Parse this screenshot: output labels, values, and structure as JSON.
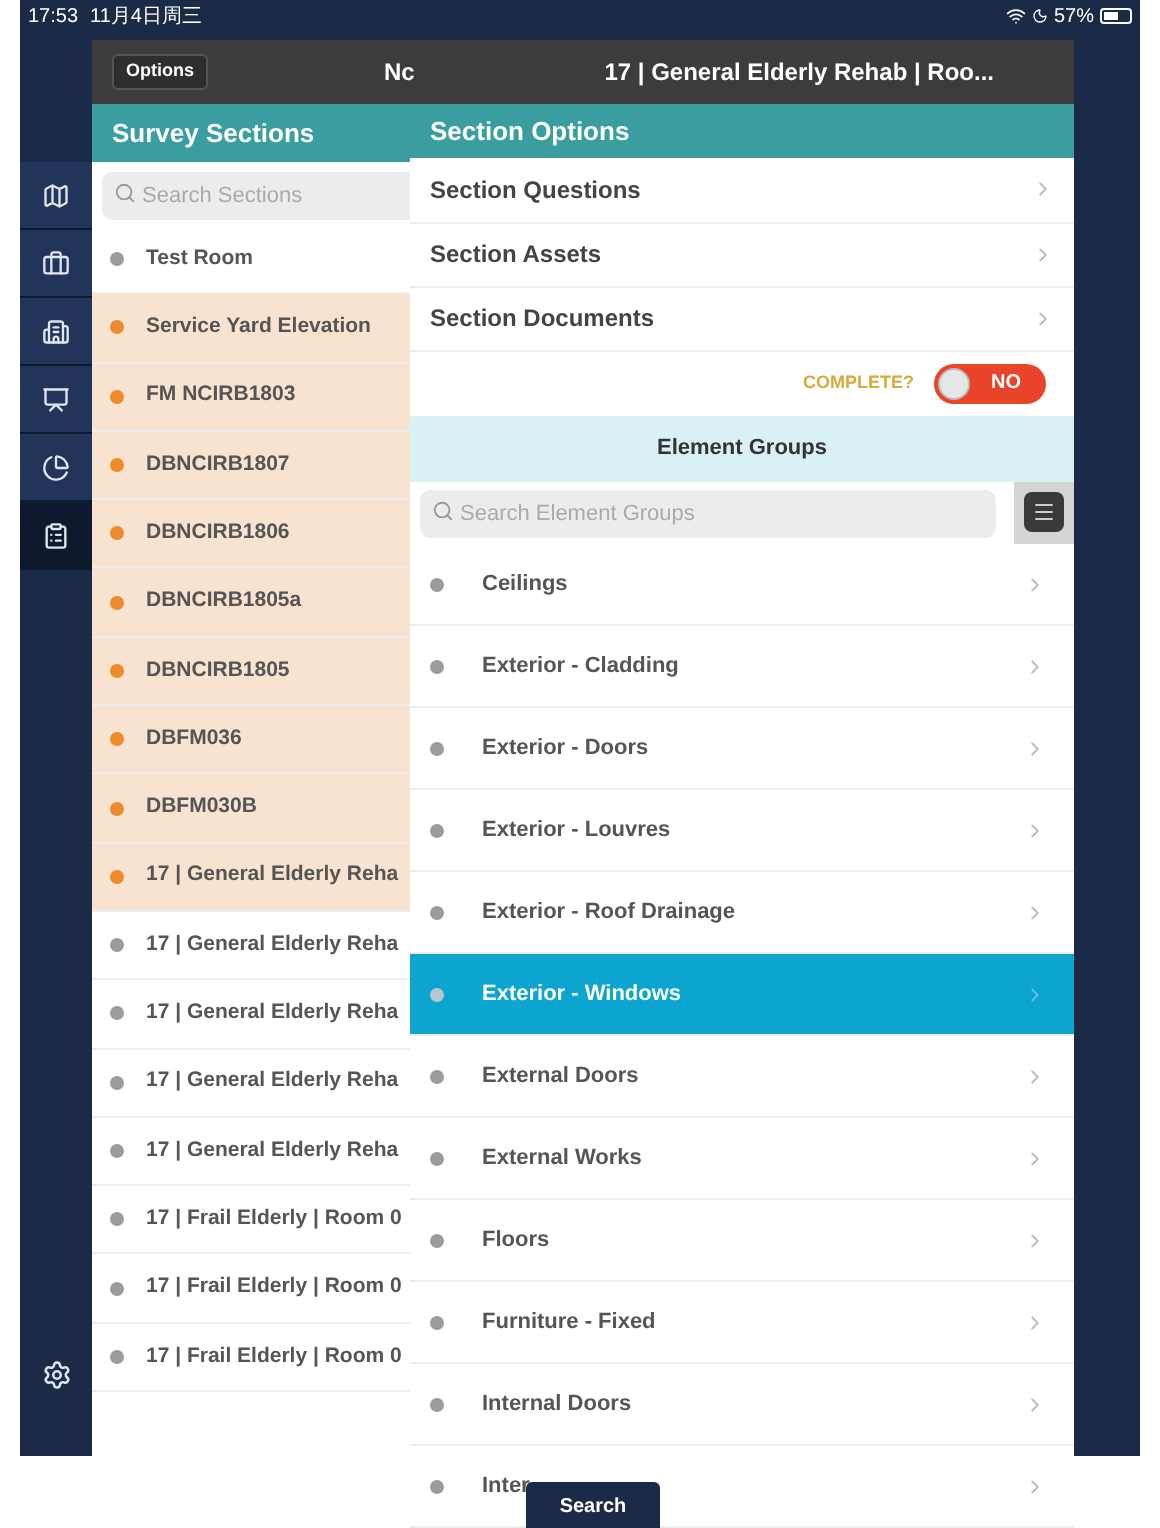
{
  "status_bar": {
    "time": "17:53",
    "date": "11月4日周三",
    "battery": "57%"
  },
  "header": {
    "options_button": "Options",
    "left_title": "Nc",
    "title": "17 | General Elderly Rehab | Roo..."
  },
  "nav_rail": [
    {
      "selected": false
    },
    {
      "selected": false
    },
    {
      "selected": false
    },
    {
      "selected": false
    },
    {
      "selected": false
    },
    {
      "selected": true
    }
  ],
  "survey_sections": {
    "title": "Survey Sections",
    "search_placeholder": "Search Sections",
    "items": [
      {
        "label": "Test Room",
        "color": "#9b9b9b",
        "highlighted": false
      },
      {
        "label": "Service Yard Elevation",
        "color": "#ef8a2c",
        "highlighted": true
      },
      {
        "label": "FM NCIRB1803",
        "color": "#ef8a2c",
        "highlighted": true
      },
      {
        "label": "DBNCIRB1807",
        "color": "#ef8a2c",
        "highlighted": true
      },
      {
        "label": "DBNCIRB1806",
        "color": "#ef8a2c",
        "highlighted": true
      },
      {
        "label": "DBNCIRB1805a",
        "color": "#ef8a2c",
        "highlighted": true
      },
      {
        "label": "DBNCIRB1805",
        "color": "#ef8a2c",
        "highlighted": true
      },
      {
        "label": "DBFM036",
        "color": "#ef8a2c",
        "highlighted": true
      },
      {
        "label": "DBFM030B",
        "color": "#ef8a2c",
        "highlighted": true
      },
      {
        "label": "17 | General Elderly Reha",
        "color": "#ef8a2c",
        "highlighted": true
      },
      {
        "label": "17 | General Elderly Reha",
        "color": "#9b9b9b",
        "highlighted": false
      },
      {
        "label": "17 | General Elderly Reha",
        "color": "#9b9b9b",
        "highlighted": false
      },
      {
        "label": "17 | General Elderly Reha",
        "color": "#9b9b9b",
        "highlighted": false
      },
      {
        "label": "17 | General Elderly Reha",
        "color": "#9b9b9b",
        "highlighted": false
      },
      {
        "label": "17 | Frail Elderly | Room 0",
        "color": "#9b9b9b",
        "highlighted": false
      },
      {
        "label": "17 | Frail Elderly | Room 0",
        "color": "#9b9b9b",
        "highlighted": false
      },
      {
        "label": "17 | Frail Elderly | Room 0",
        "color": "#9b9b9b",
        "highlighted": false
      }
    ]
  },
  "section_options": {
    "title": "Section Options",
    "items": [
      "Section Questions",
      "Section Assets",
      "Section Documents"
    ],
    "complete": {
      "label": "COMPLETE?",
      "on": false,
      "value": "NO"
    }
  },
  "element_groups": {
    "title": "Element Groups",
    "search_placeholder": "Search Element Groups",
    "items": [
      {
        "label": "Ceilings",
        "selected": false
      },
      {
        "label": "Exterior - Cladding",
        "selected": false
      },
      {
        "label": "Exterior - Doors",
        "selected": false
      },
      {
        "label": "Exterior - Louvres",
        "selected": false
      },
      {
        "label": "Exterior - Roof Drainage",
        "selected": false
      },
      {
        "label": "Exterior - Windows",
        "selected": true
      },
      {
        "label": "External Doors",
        "selected": false
      },
      {
        "label": "External Works",
        "selected": false
      },
      {
        "label": "Floors",
        "selected": false
      },
      {
        "label": "Furniture - Fixed",
        "selected": false
      },
      {
        "label": "Internal Doors",
        "selected": false
      },
      {
        "label": "Inter",
        "selected": false
      }
    ]
  },
  "search_button": "Search"
}
